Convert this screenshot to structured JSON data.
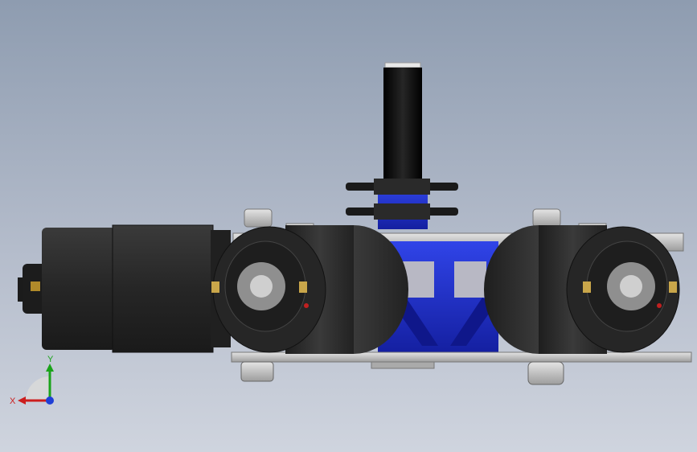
{
  "viewport": {
    "background_top": "#8e9cb0",
    "background_bottom": "#cfd4de"
  },
  "model": {
    "parts": [
      "gearmotor",
      "wheel-left",
      "wheel-right",
      "frame",
      "drive-shaft",
      "sprockets",
      "mounting-bolts"
    ],
    "colors": {
      "frame": "#1f2fd6",
      "motor": "#2b2b2b",
      "wheel": "#303030",
      "plate": "#c9c9c9",
      "shaft": "#0a0a0a"
    }
  },
  "triad": {
    "x_label": "X",
    "y_label": "Y",
    "x_color": "#cc1e1e",
    "y_color": "#1aa31a",
    "z_color": "#1f3fd6"
  }
}
